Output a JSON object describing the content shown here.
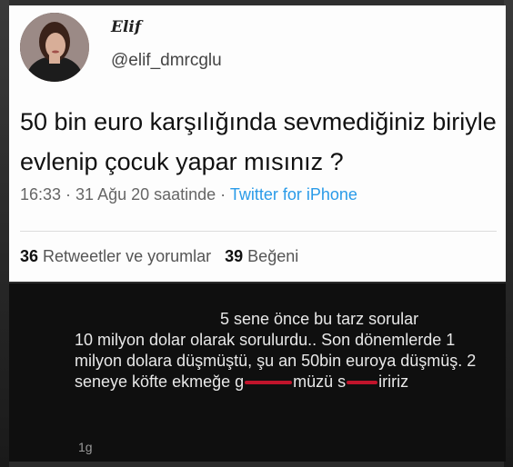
{
  "tweet": {
    "display_name": "Elif",
    "handle": "@elif_dmrcglu",
    "text": "50 bin euro karşılığında sevmediğiniz biriyle evlenip çocuk yapar mısınız ?",
    "time": "16:33 · 31 Ağu 20 saatinde · ",
    "source": "Twitter for iPhone",
    "retweets_count": "36",
    "retweets_label": "Retweetler ve yorumlar",
    "likes_count": "39",
    "likes_label": "Beğeni"
  },
  "comment": {
    "line1": "5 sene önce bu tarz sorular",
    "rest": "10 milyon dolar olarak sorulurdu.. Son dönemlerde 1 milyon dolara düşmüştü, şu an 50bin euroya düşmüş. 2 seneye köfte ekmeğe ",
    "censored_1_start": "g",
    "censored_1_end": "müzü",
    "censored_2_start": "s",
    "censored_2_end": "iririz",
    "timestamp": "1g"
  },
  "icons": {
    "avatar": "profile-photo"
  }
}
